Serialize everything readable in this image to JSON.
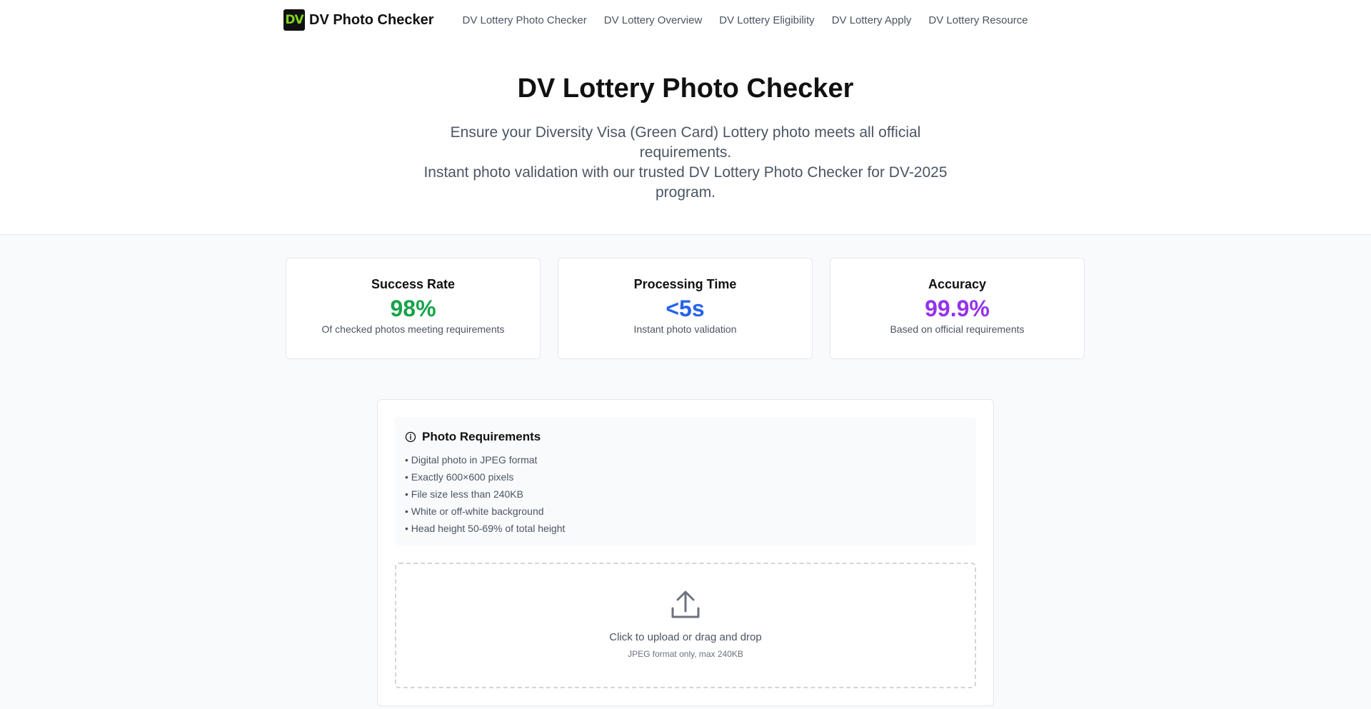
{
  "header": {
    "logo_text": "DV",
    "brand_name": "DV Photo Checker",
    "nav": [
      {
        "label": "DV Lottery Photo Checker"
      },
      {
        "label": "DV Lottery Overview"
      },
      {
        "label": "DV Lottery Eligibility"
      },
      {
        "label": "DV Lottery Apply"
      },
      {
        "label": "DV Lottery Resource"
      }
    ]
  },
  "hero": {
    "title": "DV Lottery Photo Checker",
    "line1": "Ensure your Diversity Visa (Green Card) Lottery photo meets all official requirements.",
    "line2": "Instant photo validation with our trusted DV Lottery Photo Checker for DV-2025 program."
  },
  "stats": [
    {
      "title": "Success Rate",
      "value": "98%",
      "desc": "Of checked photos meeting requirements",
      "color": "#16a34a"
    },
    {
      "title": "Processing Time",
      "value": "<5s",
      "desc": "Instant photo validation",
      "color": "#2563eb"
    },
    {
      "title": "Accuracy",
      "value": "99.9%",
      "desc": "Based on official requirements",
      "color": "#9333ea"
    }
  ],
  "requirements": {
    "icon": "info-icon",
    "title": "Photo Requirements",
    "items": [
      "• Digital photo in JPEG format",
      "• Exactly 600×600 pixels",
      "• File size less than 240KB",
      "• White or off-white background",
      "• Head height 50-69% of total height"
    ]
  },
  "upload": {
    "icon": "upload-icon",
    "main_text": "Click to upload or drag and drop",
    "sub_text": "JPEG format only, max 240KB"
  },
  "colors": {
    "logo_bg": "#111111",
    "logo_text": "#7ed321"
  }
}
